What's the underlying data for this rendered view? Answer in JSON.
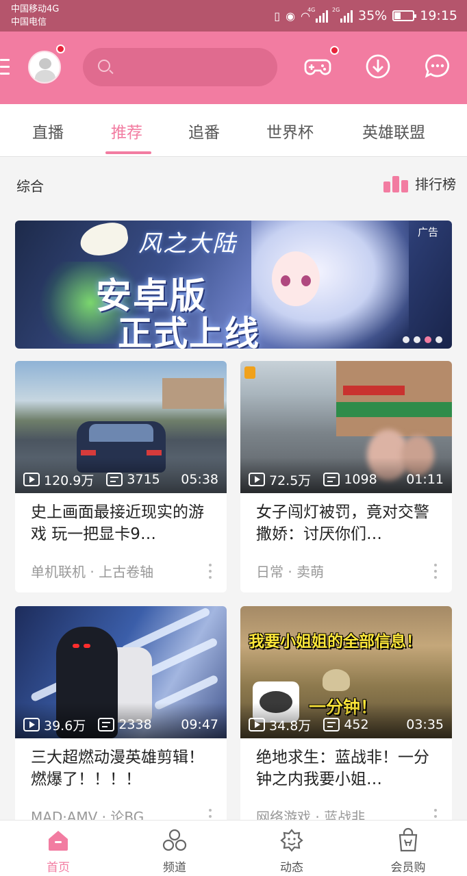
{
  "status_bar": {
    "carrier1": "中国移动4G",
    "carrier2": "中国电信",
    "net1": "4G",
    "net2": "2G",
    "battery": "35%",
    "battery_level": 0.35,
    "time": "19:15"
  },
  "header": {
    "search_placeholder": "",
    "icons": [
      "menu-icon",
      "avatar",
      "search-icon",
      "game-controller-icon",
      "download-icon",
      "chat-bubble-icon"
    ],
    "accent_color": "#f27ca1",
    "badge_color": "#e8243b"
  },
  "tabs": [
    {
      "label": "直播",
      "active": false
    },
    {
      "label": "推荐",
      "active": true
    },
    {
      "label": "追番",
      "active": false
    },
    {
      "label": "世界杯",
      "active": false
    },
    {
      "label": "英雄联盟",
      "active": false
    }
  ],
  "section": {
    "title": "综合",
    "ranking_label": "排行榜"
  },
  "banner": {
    "logo_text": "风之大陆",
    "headline_line1": "安卓版",
    "headline_line2": "正式上线",
    "ad_label": "广告",
    "slide_count": 4,
    "active_slide": 3
  },
  "cards": [
    {
      "views": "120.9万",
      "danmaku": "3715",
      "duration": "05:38",
      "title": "史上画面最接近现实的游戏 玩一把显卡9…",
      "tags": "单机联机 · 上古卷轴"
    },
    {
      "views": "72.5万",
      "danmaku": "1098",
      "duration": "01:11",
      "title": "女子闯灯被罚，竟对交警撒娇：讨厌你们…",
      "tags": "日常 · 卖萌"
    },
    {
      "views": "39.6万",
      "danmaku": "2338",
      "duration": "09:47",
      "title": "三大超燃动漫英雄剪辑！燃爆了！！！！",
      "tags": "MAD·AMV · 论BG"
    },
    {
      "views": "34.8万",
      "danmaku": "452",
      "duration": "03:35",
      "title": "绝地求生：蓝战非！一分钟之内我要小姐…",
      "tags": "网络游戏 · 蓝战非",
      "thumb_caption1": "我要小姐姐的全部信息！",
      "thumb_caption2": "一分钟！"
    }
  ],
  "bottom_nav": [
    {
      "label": "首页",
      "icon": "home-icon",
      "active": true
    },
    {
      "label": "频道",
      "icon": "channels-icon",
      "active": false
    },
    {
      "label": "动态",
      "icon": "dynamics-icon",
      "active": false
    },
    {
      "label": "会员购",
      "icon": "member-shop-icon",
      "active": false
    }
  ]
}
